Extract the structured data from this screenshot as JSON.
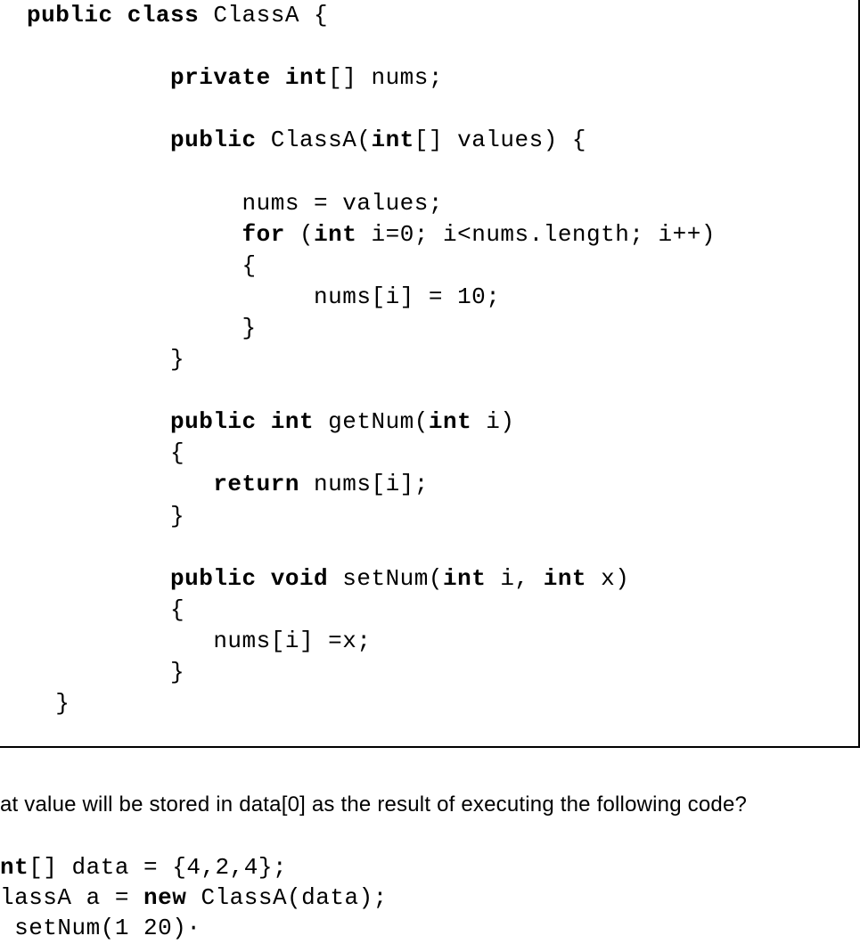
{
  "code_block": {
    "line1_a": "public class",
    "line1_b": " ClassA {",
    "line2_a": "          private int",
    "line2_b": "[] nums;",
    "line3_a": "          public",
    "line3_b": " ClassA(",
    "line3_c": "int",
    "line3_d": "[] values) {",
    "line4": "               nums = values;",
    "line5_a": "               for",
    "line5_b": " (",
    "line5_c": "int",
    "line5_d": " i=0; i<nums.length; i++)",
    "line6": "               {",
    "line7": "                    nums[i] = 10;",
    "line8": "               }",
    "line9": "          }",
    "line10_a": "          public int",
    "line10_b": " getNum(",
    "line10_c": "int",
    "line10_d": " i)",
    "line11": "          {",
    "line12_a": "             return",
    "line12_b": " nums[i];",
    "line13": "          }",
    "line14_a": "          public void",
    "line14_b": " setNum(",
    "line14_c": "int",
    "line14_d": " i, ",
    "line14_e": "int",
    "line14_f": " x)",
    "line15": "          {",
    "line16": "             nums[i] =x;",
    "line17": "          }",
    "line18": "  }"
  },
  "question_text": "at value will be stored in data[0] as the result of executing the following code?",
  "snippet": {
    "s1_a": "nt",
    "s1_b": "[] data = {4,2,4};",
    "s2_a": "lassA a = ",
    "s2_b": "new",
    "s2_c": " ClassA(data);",
    "s3": " setNum(1 20)·"
  }
}
